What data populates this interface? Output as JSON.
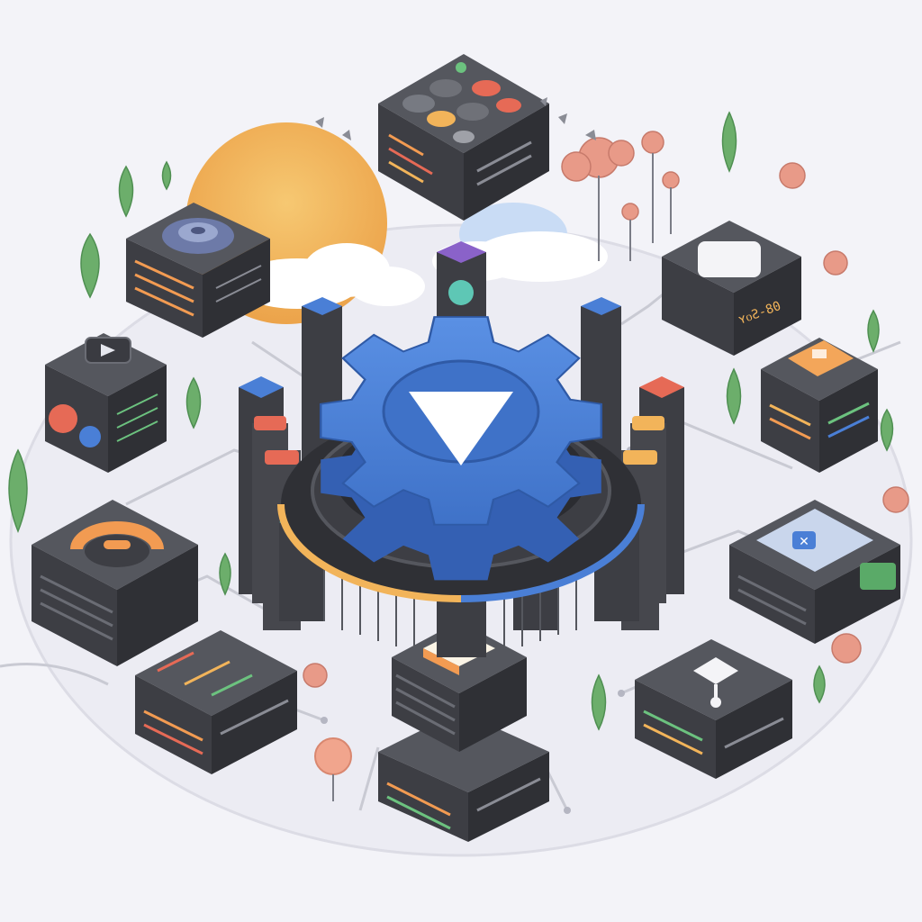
{
  "colors": {
    "background": "#f3f3f8",
    "ground": "#ececf3",
    "server_dark": "#3d3e44",
    "server_side": "#2f3035",
    "server_top": "#55575e",
    "gear_blue": "#4a7fd6",
    "gear_blue_dark": "#3460b3",
    "sun": "#f0b45a",
    "leaf_green": "#6cae6b",
    "blossom_pink": "#e89a88",
    "accent_orange": "#f29b52",
    "accent_red": "#e66a56",
    "accent_teal": "#5ec7b5",
    "accent_purple": "#8a62c9",
    "circuit_line": "#c9cad3"
  },
  "screen_labels": {
    "right_panel": "ʏᴏƧ-80"
  },
  "icons": {
    "center": "gear-play-icon",
    "top_module": "toggle-grid-icon",
    "top_left_module": "disk-icon",
    "left_module": "play-icon",
    "left_mid_module": "headphones-icon",
    "right_top_module": "blank-tile-icon",
    "right_mid_module": "square-badge-icon",
    "right_low_module": "close-icon",
    "bottom_right_module": "fork-icon",
    "bottom_center_module": "tile-icon"
  }
}
